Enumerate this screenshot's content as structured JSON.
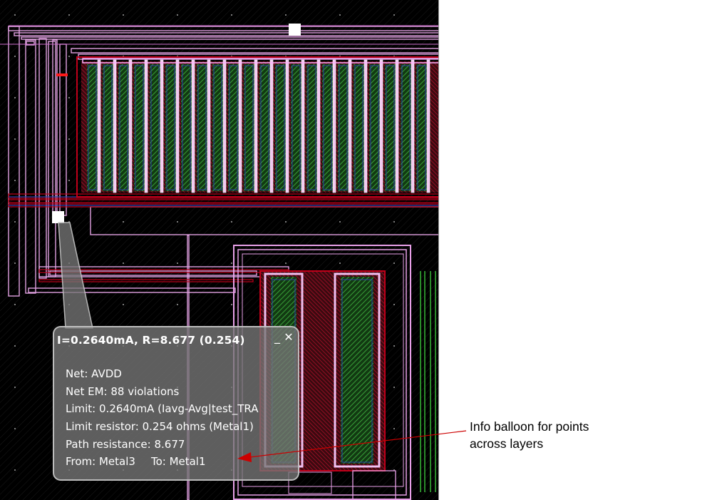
{
  "balloon": {
    "title": "I=0.2640mA, R=8.677 (0.254)",
    "minimize_glyph": "_",
    "close_glyph": "✕",
    "lines": {
      "net": "Net: AVDD",
      "net_em": "Net EM: 88 violations",
      "limit": "Limit: 0.2640mA (Iavg-Avg|test_TRA",
      "limit_resistor": "Limit resistor: 0.254 ohms (Metal1)",
      "path_resistance": "Path resistance: 8.677",
      "from": "From: Metal3",
      "to": "To: Metal1"
    }
  },
  "annotation": {
    "line1": "Info balloon for points",
    "line2": "across layers",
    "arrow_color": "#cc0000"
  },
  "colors": {
    "canvas_bg": "#000000",
    "pink_outline": "#e89ce8",
    "metal_red": "#c0001a",
    "diffusion_green": "#2a8a2a",
    "poly_blue": "#2f3fa8",
    "marker": "#ffffff"
  }
}
